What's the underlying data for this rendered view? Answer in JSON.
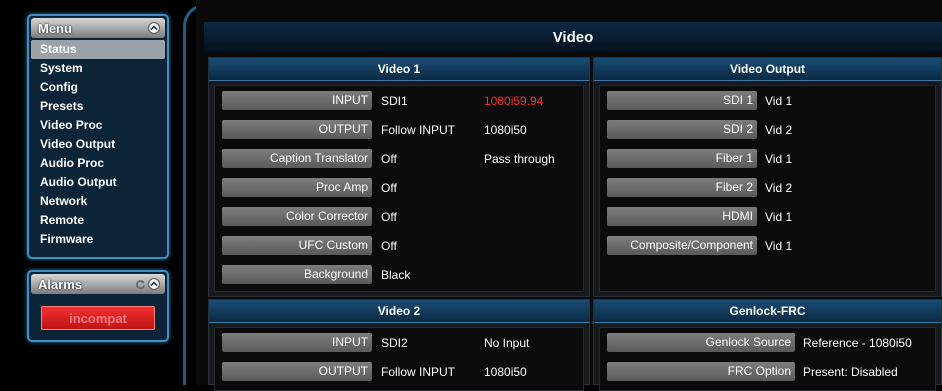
{
  "sidebar": {
    "menu_title": "Menu",
    "menu_items": [
      "Status",
      "System",
      "Config",
      "Presets",
      "Video Proc",
      "Video Output",
      "Audio Proc",
      "Audio Output",
      "Network",
      "Remote",
      "Firmware"
    ],
    "alarms_title": "Alarms",
    "alarm_button": "incompat"
  },
  "main": {
    "title": "Video",
    "video1": {
      "title": "Video 1",
      "rows": [
        {
          "label": "INPUT",
          "value": "SDI1",
          "extra": "1080i59.94"
        },
        {
          "label": "OUTPUT",
          "value": "Follow INPUT",
          "extra": "1080i50"
        },
        {
          "label": "Caption Translator",
          "value": "Off",
          "extra": "Pass through"
        },
        {
          "label": "Proc Amp",
          "value": "Off",
          "extra": ""
        },
        {
          "label": "Color Corrector",
          "value": "Off",
          "extra": ""
        },
        {
          "label": "UFC Custom",
          "value": "Off",
          "extra": ""
        },
        {
          "label": "Background",
          "value": "Black",
          "extra": ""
        }
      ]
    },
    "video_output": {
      "title": "Video Output",
      "rows": [
        {
          "label": "SDI 1",
          "value": "Vid 1"
        },
        {
          "label": "SDI 2",
          "value": "Vid 2"
        },
        {
          "label": "Fiber 1",
          "value": "Vid 1"
        },
        {
          "label": "Fiber 2",
          "value": "Vid 2"
        },
        {
          "label": "HDMI",
          "value": "Vid 1"
        },
        {
          "label": "Composite/Component",
          "value": "Vid 1"
        }
      ]
    },
    "video2": {
      "title": "Video 2",
      "rows": [
        {
          "label": "INPUT",
          "value": "SDI2",
          "extra": "No Input"
        },
        {
          "label": "OUTPUT",
          "value": "Follow INPUT",
          "extra": "1080i50"
        }
      ]
    },
    "genlock": {
      "title": "Genlock-FRC",
      "rows": [
        {
          "label": "Genlock Source",
          "value": "Reference - 1080i50"
        },
        {
          "label": "FRC Option",
          "value": "Present: Disabled"
        }
      ]
    }
  },
  "colors": {
    "accent": "#3f8fc0",
    "alarm": "#e02020",
    "warning_text": "#ff2a2a"
  }
}
